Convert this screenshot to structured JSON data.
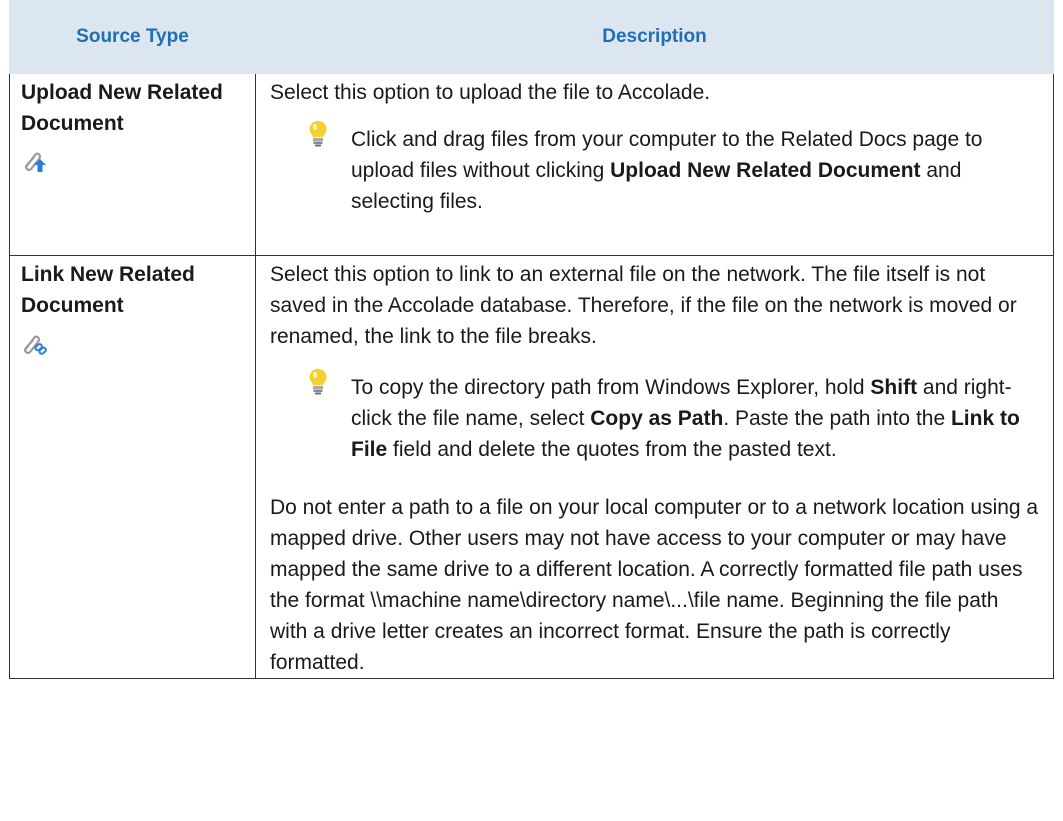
{
  "table": {
    "headers": {
      "source_type": "Source Type",
      "description": "Description"
    },
    "rows": [
      {
        "type_label": "Upload New Related Document",
        "icon": "upload-document-icon",
        "desc": "Select this option to upload the file to Accolade.",
        "tip": {
          "icon": "lightbulb-icon",
          "t1": "Click and drag files from your computer to the Related Docs page to upload files without clicking ",
          "b1": "Upload New Related Document",
          "t2": " and selecting files."
        }
      },
      {
        "type_label": "Link New Related Document",
        "icon": "link-document-icon",
        "desc": "Select this option to link to an external file on the network. The file itself is not saved in the Accolade database. Therefore, if the file on the network is moved or renamed, the link to the file breaks.",
        "tip": {
          "icon": "lightbulb-icon",
          "t1": "To copy the directory path from Windows Explorer, hold ",
          "b1": "Shift",
          "t2": " and right-click the file name, select ",
          "b2": "Copy as Path",
          "t3": ". Paste the path into the ",
          "b3": "Link to File",
          "t4": " field and delete the quotes from the pasted text."
        },
        "note": "Do not enter a path to a file on your local computer or to a network location using a mapped drive. Other users may not have access to your computer or may have mapped the same drive to a different location. A correctly formatted file path uses the format \\\\machine name\\directory name\\...\\file name. Beginning the file path with a drive letter creates an incorrect format. Ensure the path is correctly formatted."
      }
    ]
  },
  "colors": {
    "header_bg": "#dce6f1",
    "header_text": "#1f6fb2",
    "icon_blue": "#2a7fd4",
    "bulb_yellow": "#f2d22e"
  }
}
